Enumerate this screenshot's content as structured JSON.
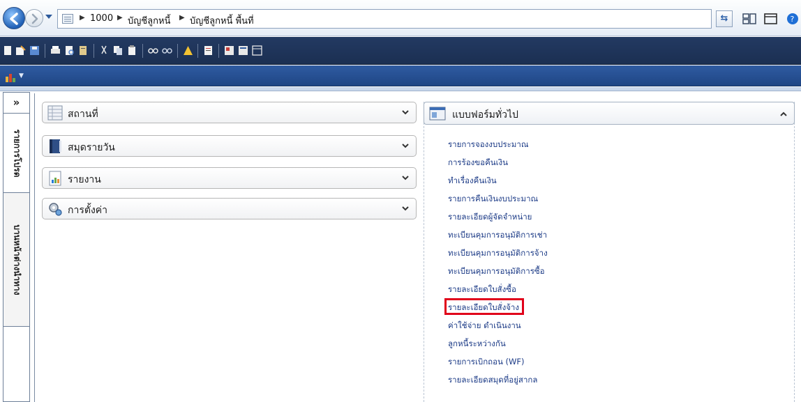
{
  "breadcrumb": [
    "1000",
    "บัญชีลูกหนี้",
    "บัญชีลูกหนี้ พื้นที่"
  ],
  "left_panel": {
    "collapse_glyph": "»",
    "tabs": [
      "รายการโปรด",
      "บานหน้าต่างนำทาง"
    ]
  },
  "panes": [
    {
      "label": "สถานที่",
      "icon": "grid-list-icon"
    },
    {
      "label": "สมุดรายวัน",
      "icon": "journal-book-icon"
    },
    {
      "label": "รายงาน",
      "icon": "report-chart-icon"
    },
    {
      "label": "การตั้งค่า",
      "icon": "settings-gears-icon"
    }
  ],
  "general_forms": {
    "title": "แบบฟอร์มทั่วไป",
    "links": [
      "รายการจองงบประมาณ",
      "การร้องขอคืนเงิน",
      "ทำเรื่องคืนเงิน",
      "รายการคืนเงินงบประมาณ",
      "รายละเอียดผู้จัดจำหน่าย",
      "ทะเบียนคุมการอนุมัติการเช่า",
      "ทะเบียนคุมการอนุมัติการจ้าง",
      "ทะเบียนคุมการอนุมัติการซื้อ",
      "รายละเอียดใบสั่งซื้อ",
      "รายละเอียดใบสั่งจ้าง",
      "ค่าใช้จ่าย ดำเนินงาน",
      "ลูกหนี้ระหว่างกัน",
      "รายการเบิกถอน (WF)",
      "รายละเอียดสมุดที่อยู่สากล"
    ],
    "highlighted_link_index": 9
  },
  "colors": {
    "toolbar_bg": "#1f3459",
    "highlight_box": "#e0001a",
    "link": "#1b3a86"
  }
}
